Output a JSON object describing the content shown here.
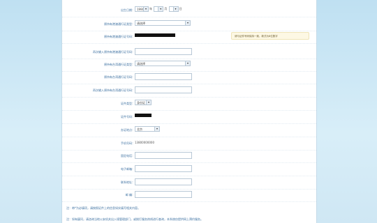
{
  "form": {
    "rows": [
      {
        "label": "出生日期：",
        "type": "date",
        "year": "1990",
        "month": "",
        "day": ""
      },
      {
        "label": "原持有港澳通行证类型：",
        "type": "select",
        "value": "请选择"
      },
      {
        "label": "原持有港澳通行证号码：",
        "type": "redacted",
        "tip": "请与证件号码保持一致，新式为8位数字"
      },
      {
        "label": "再次输入原持有港澳通行证号码：",
        "type": "input"
      },
      {
        "label": "原持有台湾通行证类型：",
        "type": "select",
        "value": "请选择"
      },
      {
        "label": "原持有台湾通行证号码：",
        "type": "input"
      },
      {
        "label": "再次输入原持有台湾通行证号码：",
        "type": "input"
      },
      {
        "label": "证件类型：",
        "type": "select",
        "value": "身份证"
      },
      {
        "label": "证件号码：",
        "type": "redacted-short"
      },
      {
        "label": "办证地点：",
        "type": "select",
        "value": "北京"
      },
      {
        "label": "手机号码：",
        "type": "plain",
        "value": "13800000000"
      },
      {
        "label": "固定电话：",
        "type": "input"
      },
      {
        "label": "电子邮箱：",
        "type": "input"
      },
      {
        "label": "联系地址：",
        "type": "input"
      },
      {
        "label": "邮  编：",
        "type": "input"
      }
    ],
    "date_labels": {
      "year": "年",
      "month": "月",
      "day": "日"
    },
    "notes": [
      "注：带*为必填项，请按照证件上的信息如实填写相关内容。",
      "注：如有疑问，请咨询当地公安机关出入境管理部门，或拨打服务热线进行查询，本系统仅提供网上预约服务。"
    ]
  }
}
